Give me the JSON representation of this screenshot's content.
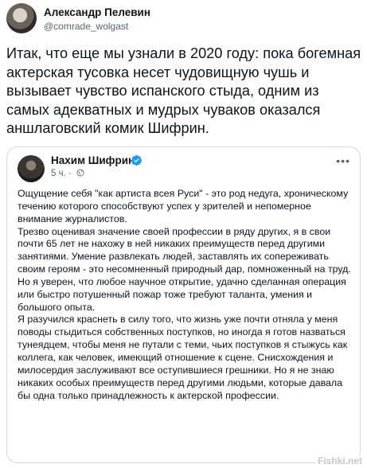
{
  "tweet": {
    "author_name": "Александр Пелевин",
    "author_handle": "@comrade_wolgast",
    "text": "Итак, что еще мы узнали в 2020 году: пока богемная актерская тусовка несет чудовищную чушь и вызывает чувство испанского стыда, одним из самых адекватных и мудрых чуваков оказался аншлаговский комик Шифрин."
  },
  "quoted_post": {
    "author_name": "Нахим Шифрин",
    "time": "5 ч.",
    "separator": "·",
    "more_label": "•••",
    "paragraphs": [
      "Ощущение себя \"как артиста всея Руси\" - это род недуга, хроническому течению которого способствуют успех у зрителей и непомерное внимание журналистов.",
      "Трезво оценивая значение своей профессии в ряду других, я в свои почти 65 лет не нахожу в ней никаких преимуществ перед другими занятиями. Умение развлекать людей, заставлять их сопереживать своим героям - это несомненный природный дар, помноженный на труд.",
      "Но я уверен, что любое научное открытие, удачно сделанная операция или быстро потушенный пожар тоже требуют таланта, умения и большого опыта.",
      "Я разучился краснеть в силу того, что жизнь уже почти отняла у меня поводы стыдиться собственных поступков, но иногда я готов назваться тунеядцем, чтобы меня не путали с теми, чьих поступков я стыжусь как коллега, как  человек, имеющий отношение к сцене. Снисхождения и милосердия заслуживают все оступившиеся грешники. Но я не знаю никаких особых преимуществ перед другими людьми, которые давала бы одна только принадлежность к актерской профессии."
    ]
  },
  "watermark": "Fishki.net",
  "colors": {
    "verified": "#1d9bf0",
    "secondary_text": "#536471",
    "border": "#cfd9de"
  }
}
